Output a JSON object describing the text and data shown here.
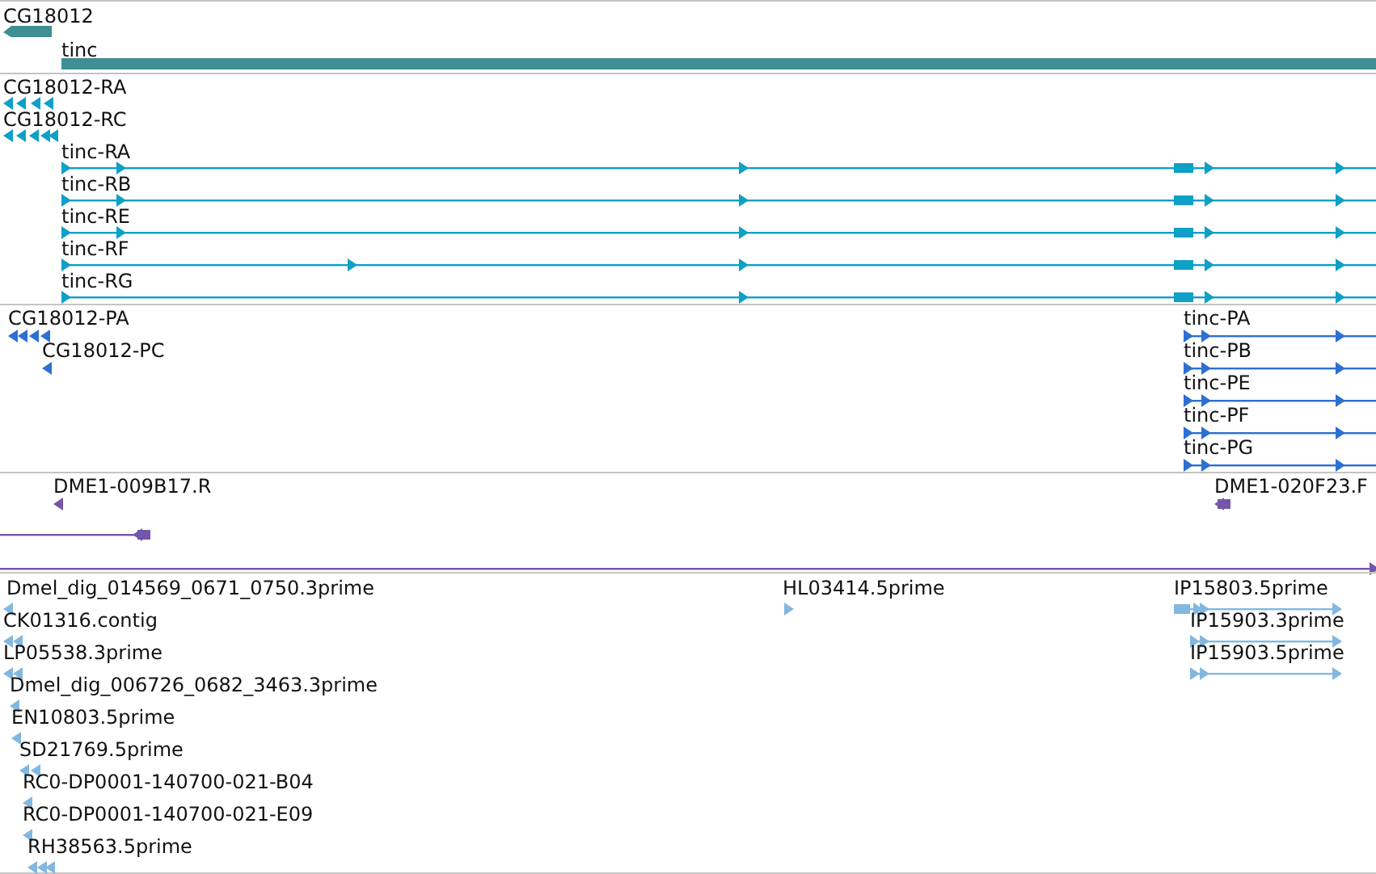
{
  "tracks": [
    {
      "color": "#3f8f94",
      "features": [
        {
          "label": "CG18012"
        },
        {
          "label": "tinc"
        }
      ]
    },
    {
      "color": "#0fa0c6",
      "features": [
        {
          "label": "CG18012-RA"
        },
        {
          "label": "CG18012-RC"
        },
        {
          "label": "tinc-RA"
        },
        {
          "label": "tinc-RB"
        },
        {
          "label": "tinc-RE"
        },
        {
          "label": "tinc-RF"
        },
        {
          "label": "tinc-RG"
        }
      ]
    },
    {
      "color": "#2e6fd2",
      "features": [
        {
          "label": "CG18012-PA"
        },
        {
          "label": "CG18012-PC"
        },
        {
          "label": "tinc-PA"
        },
        {
          "label": "tinc-PB"
        },
        {
          "label": "tinc-PE"
        },
        {
          "label": "tinc-PF"
        },
        {
          "label": "tinc-PG"
        }
      ]
    },
    {
      "color": "#7356aa",
      "features": [
        {
          "kind": "end",
          "label": "DME1-009B17.R"
        },
        {
          "kind": "end",
          "label": "DME1-020F23.F"
        },
        {
          "kind": "span"
        },
        {
          "kind": "span"
        }
      ]
    },
    {
      "color": "#82b8e0",
      "features": [
        {
          "label": "Dmel_dig_014569_0671_0750.3prime"
        },
        {
          "label": "HL03414.5prime"
        },
        {
          "label": "IP15803.5prime"
        },
        {
          "label": "CK01316.contig"
        },
        {
          "label": "IP15903.3prime"
        },
        {
          "label": "LP05538.3prime"
        },
        {
          "label": "IP15903.5prime"
        },
        {
          "label": "Dmel_dig_006726_0682_3463.3prime"
        },
        {
          "label": "EN10803.5prime"
        },
        {
          "label": "SD21769.5prime"
        },
        {
          "label": "RC0-DP0001-140700-021-B04"
        },
        {
          "label": "RC0-DP0001-140700-021-E09"
        },
        {
          "label": "RH38563.5prime"
        }
      ]
    }
  ]
}
